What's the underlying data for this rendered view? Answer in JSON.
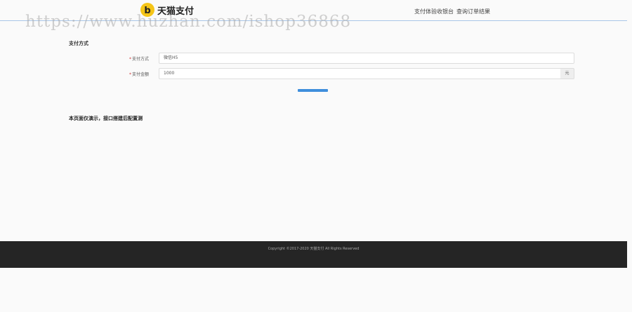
{
  "header": {
    "logo_glyph": "b",
    "logo_text": "天猫支付",
    "links": [
      "支付体验收银台",
      "查询订单结果"
    ]
  },
  "watermark": "https://www.huzhan.com/ishop36868",
  "form": {
    "section_title": "支付方式",
    "fields": [
      {
        "required_mark": "*",
        "label": "支付方式",
        "value": "微信H5"
      },
      {
        "required_mark": "*",
        "label": "支付金额",
        "value": "1000",
        "addon": "元"
      }
    ]
  },
  "notice": "本页面仅演示，接口搭建后配置测",
  "footer": {
    "copyright": "Copyright ©2017-2020 天猫支付 All Rights Reserved"
  },
  "colors": {
    "accent": "#3f8fdc",
    "logo": "#f5c518",
    "footer_bg": "#252525"
  }
}
